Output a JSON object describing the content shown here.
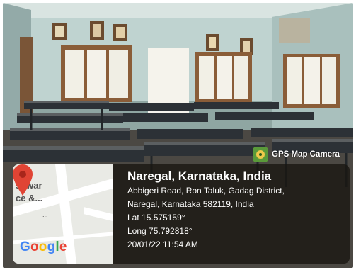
{
  "badge": {
    "app_name": "GPS Map Camera",
    "icon": "camera-icon"
  },
  "map": {
    "label_line1": "shwar",
    "label_line2": "ce &...",
    "label_dots": "...",
    "pin_color": "#e04434",
    "provider_logo": "Google"
  },
  "location": {
    "title": "Naregal, Karnataka, India",
    "address_line1": "Abbigeri Road, Ron Taluk, Gadag District,",
    "address_line2": "Naregal, Karnataka 582119, India",
    "latitude": "Lat 15.575159°",
    "longitude": "Long 75.792818°",
    "timestamp": "20/01/22 11:54 AM"
  }
}
